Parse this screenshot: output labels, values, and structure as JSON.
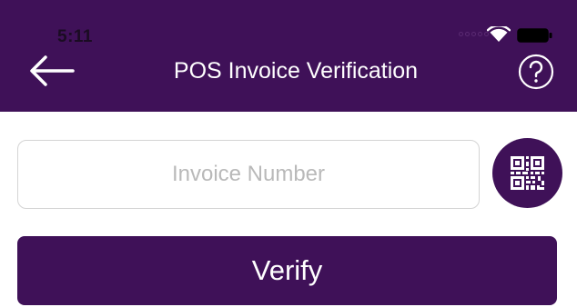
{
  "status_bar": {
    "time": "5:11"
  },
  "header": {
    "title": "POS Invoice Verification",
    "back_icon": "arrow-left-icon",
    "help_icon": "question-circle-icon"
  },
  "form": {
    "invoice_input": {
      "value": "",
      "placeholder": "Invoice Number"
    },
    "scan_icon": "qr-code-icon",
    "verify_label": "Verify"
  },
  "colors": {
    "brand": "#3f1158",
    "input_border": "#d4d4d4",
    "placeholder": "#b9b9b9"
  }
}
